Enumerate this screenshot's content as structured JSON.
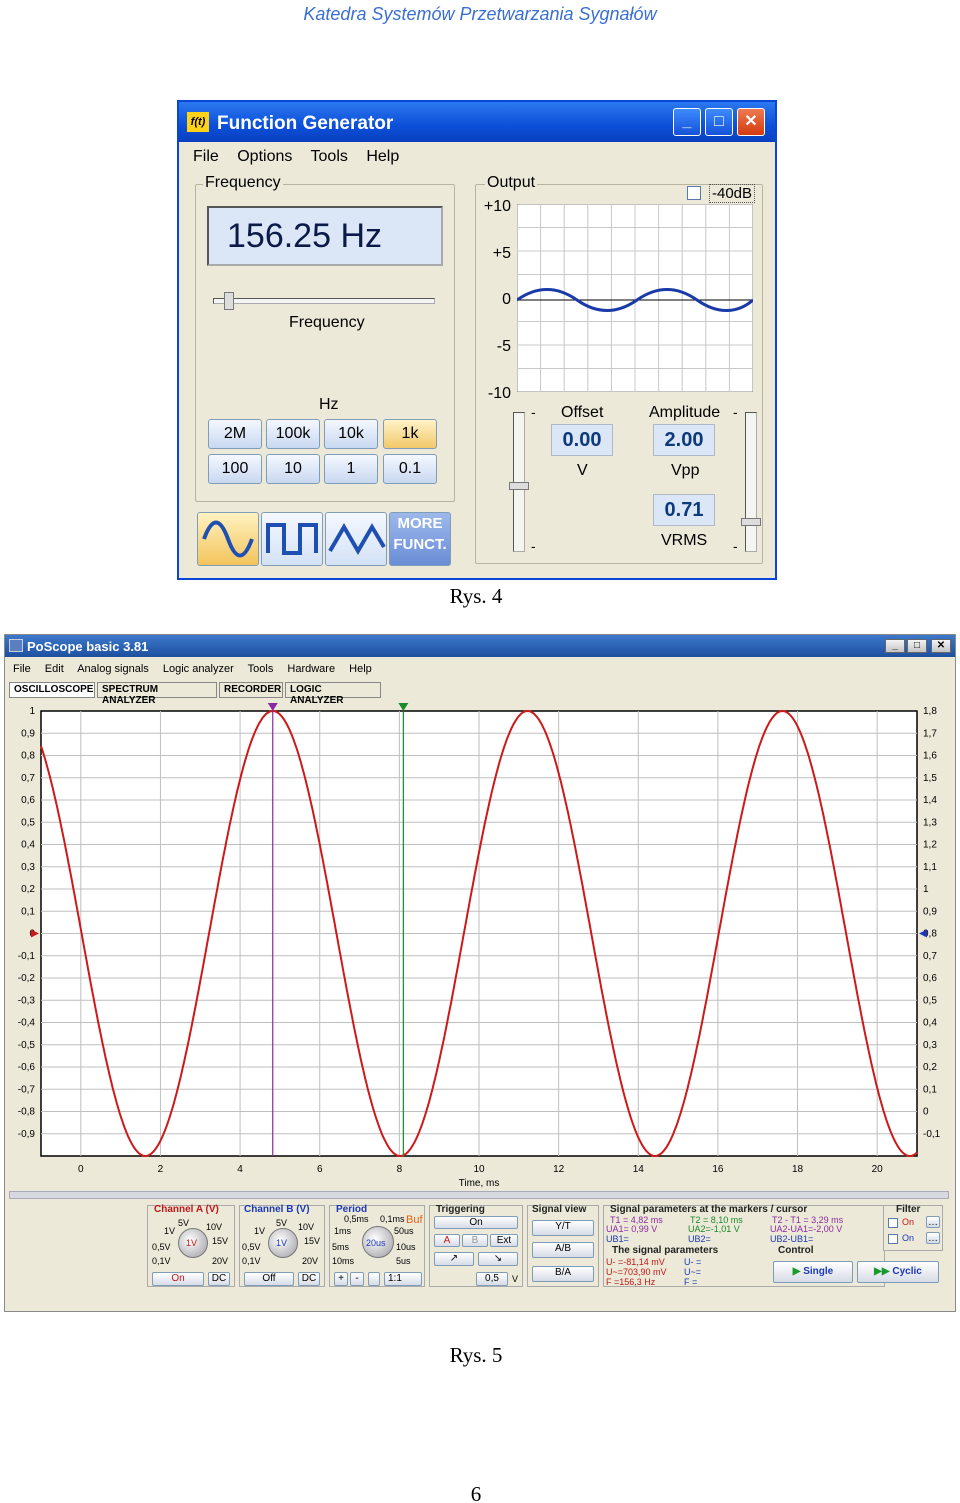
{
  "header": "Katedra Systemów Przetwarzania Sygnałów",
  "fg": {
    "logo": "f(t)",
    "title": "Function Generator",
    "menu": [
      "File",
      "Options",
      "Tools",
      "Help"
    ],
    "frequency_group": "Frequency",
    "frequency_display": "156.25 Hz",
    "frequency_slider_label": "Frequency",
    "hz_label": "Hz",
    "hz_buttons_row1": [
      "2M",
      "100k",
      "10k",
      "1k"
    ],
    "hz_buttons_row2": [
      "100",
      "10",
      "1",
      "0.1"
    ],
    "more_funct_1": "MORE",
    "more_funct_2": "FUNCT.",
    "output_group": "Output",
    "db_checkbox": "-40dB",
    "output_axis": [
      "+10",
      "+5",
      "0",
      "-5",
      "-10"
    ],
    "offset_label": "Offset",
    "offset_value": "0.00",
    "offset_unit": "V",
    "amplitude_label": "Amplitude",
    "amplitude_value": "2.00",
    "amplitude_unit": "Vpp",
    "vrms_value": "0.71",
    "vrms_unit": "VRMS",
    "minus": "-"
  },
  "caption1": "Rys. 4",
  "ps": {
    "title": "PoScope basic 3.81",
    "menu": [
      "File",
      "Edit",
      "Analog signals",
      "Logic analyzer",
      "Tools",
      "Hardware",
      "Help"
    ],
    "tabs": [
      "OSCILLOSCOPE",
      "SPECTRUM ANALYZER",
      "RECORDER",
      "LOGIC ANALYZER"
    ],
    "y_left": [
      "1",
      "0,9",
      "0,8",
      "0,7",
      "0,6",
      "0,5",
      "0,4",
      "0,3",
      "0,2",
      "0,1",
      "0",
      "-0,1",
      "-0,2",
      "-0,3",
      "-0,4",
      "-0,5",
      "-0,6",
      "-0,7",
      "-0,8",
      "-0,9"
    ],
    "y_right": [
      "1,8",
      "1,7",
      "1,6",
      "1,5",
      "1,4",
      "1,3",
      "1,2",
      "1,1",
      "1",
      "0,9",
      "0,8",
      "0,7",
      "0,6",
      "0,5",
      "0,4",
      "0,3",
      "0,2",
      "0,1",
      "0",
      "-0,1"
    ],
    "x_ticks": [
      "0",
      "2",
      "4",
      "6",
      "8",
      "10",
      "12",
      "14",
      "16",
      "18",
      "20"
    ],
    "x_title": "Time, ms",
    "marker1": "T1",
    "marker2": "T2",
    "channel_a": {
      "title": "Channel A (V)",
      "k1": "5V",
      "k2": "10V",
      "k3": "1V",
      "k4": "15V",
      "k5": "0,5V",
      "k6": "20V",
      "k7": "0,1V",
      "knob": "1V",
      "on": "On",
      "dc": "DC"
    },
    "channel_b": {
      "title": "Channel B (V)",
      "k1": "5V",
      "k2": "10V",
      "k3": "1V",
      "k4": "15V",
      "k5": "0,5V",
      "k6": "20V",
      "k7": "0,1V",
      "knob": "1V",
      "off": "Off",
      "dc": "DC"
    },
    "period": {
      "title": "Period",
      "k1": "0,5ms",
      "k2": "0,1ms",
      "buf": "Buf",
      "k3": "1ms",
      "k4": "50us",
      "k5": "5ms",
      "k6": "10us",
      "k7": "10ms",
      "k8": "5us",
      "knob": "20us",
      "ratio": "1:1"
    },
    "trigger": {
      "title": "Triggering",
      "on": "On",
      "a": "A",
      "b": "B",
      "ext": "Ext",
      "level": "0,5",
      "unit": "V"
    },
    "signal_view": {
      "title": "Signal view",
      "yt": "Y/T",
      "ab": "A/B",
      "ba": "B/A"
    },
    "params": {
      "title": "Signal parameters at the markers / cursor",
      "t1": "T1 = 4,82 ms",
      "t2": "T2 = 8,10 ms",
      "dt": "T2 - T1 = 3,29 ms",
      "ua1": "UA1= 0,99 V",
      "ua2": "UA2=-1,01 V",
      "dua": "UA2-UA1=-2,00 V",
      "ub1": "UB1=",
      "ub2": "UB2=",
      "dub": "UB2-UB1=",
      "sig_title": "The signal parameters",
      "um": "U- =-81,14 mV",
      "urms": "U~=703,90 mV",
      "f": "F =156,3 Hz",
      "um_b": "U- =",
      "urms_b": "U~=",
      "f_b": "F ="
    },
    "control": {
      "title": "Control",
      "single": "Single",
      "cyclic": "Cyclic"
    },
    "filter": {
      "title": "Filter",
      "on1": "On",
      "on2": "On"
    }
  },
  "chart_data": {
    "type": "line",
    "title": "",
    "xlabel": "Time, ms",
    "ylabel": "",
    "xlim": [
      -1,
      21
    ],
    "ylim": [
      -1,
      1
    ],
    "series": [
      {
        "function": "sine",
        "amplitude": 1,
        "frequency_hz": 156.25,
        "peak_time_ms": 4.82
      }
    ],
    "markers": [
      {
        "name": "T1",
        "x": 4.82
      },
      {
        "name": "T2",
        "x": 8.1
      }
    ],
    "grid": true,
    "colors": {
      "signal": "#cc1a1a",
      "grid": "#bfbfbf",
      "marker1": "#8a2aa0",
      "marker2": "#1a8a2a"
    }
  },
  "caption2": "Rys. 5",
  "page_number": "6"
}
